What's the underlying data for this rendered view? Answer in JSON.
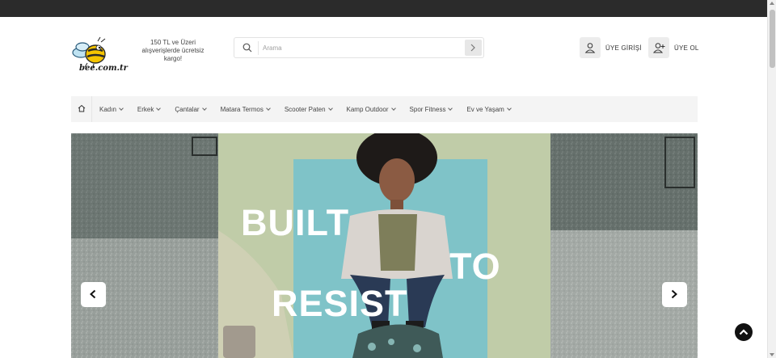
{
  "header": {
    "logo_text": "bee.com.tr",
    "promo_text": "150 TL ve Üzeri alışverişlerde ücretsiz kargo!"
  },
  "search": {
    "placeholder": "Arama",
    "icon": "search-icon",
    "submit_icon": "chevron-right-icon"
  },
  "account": {
    "login_label": "ÜYE GİRİŞİ",
    "login_icon": "user-icon",
    "register_label": "ÜYE OL",
    "register_icon": "user-plus-icon"
  },
  "nav": {
    "home_icon": "home-icon",
    "items": [
      {
        "label": "Kadın"
      },
      {
        "label": "Erkek"
      },
      {
        "label": "Çantalar"
      },
      {
        "label": "Matara Termos"
      },
      {
        "label": "Scooter Paten"
      },
      {
        "label": "Kamp Outdoor"
      },
      {
        "label": "Spor Fitness"
      },
      {
        "label": "Ev ve Yaşam"
      }
    ]
  },
  "hero": {
    "line1": "BUILT",
    "line2": "TO",
    "line3": "RESIST",
    "prev_icon": "chevron-left-icon",
    "next_icon": "chevron-right-icon"
  },
  "colors": {
    "topbar": "#2b2b2b",
    "nav_bg": "#f4f4f4",
    "hero_panel": "#7fc3c8"
  }
}
